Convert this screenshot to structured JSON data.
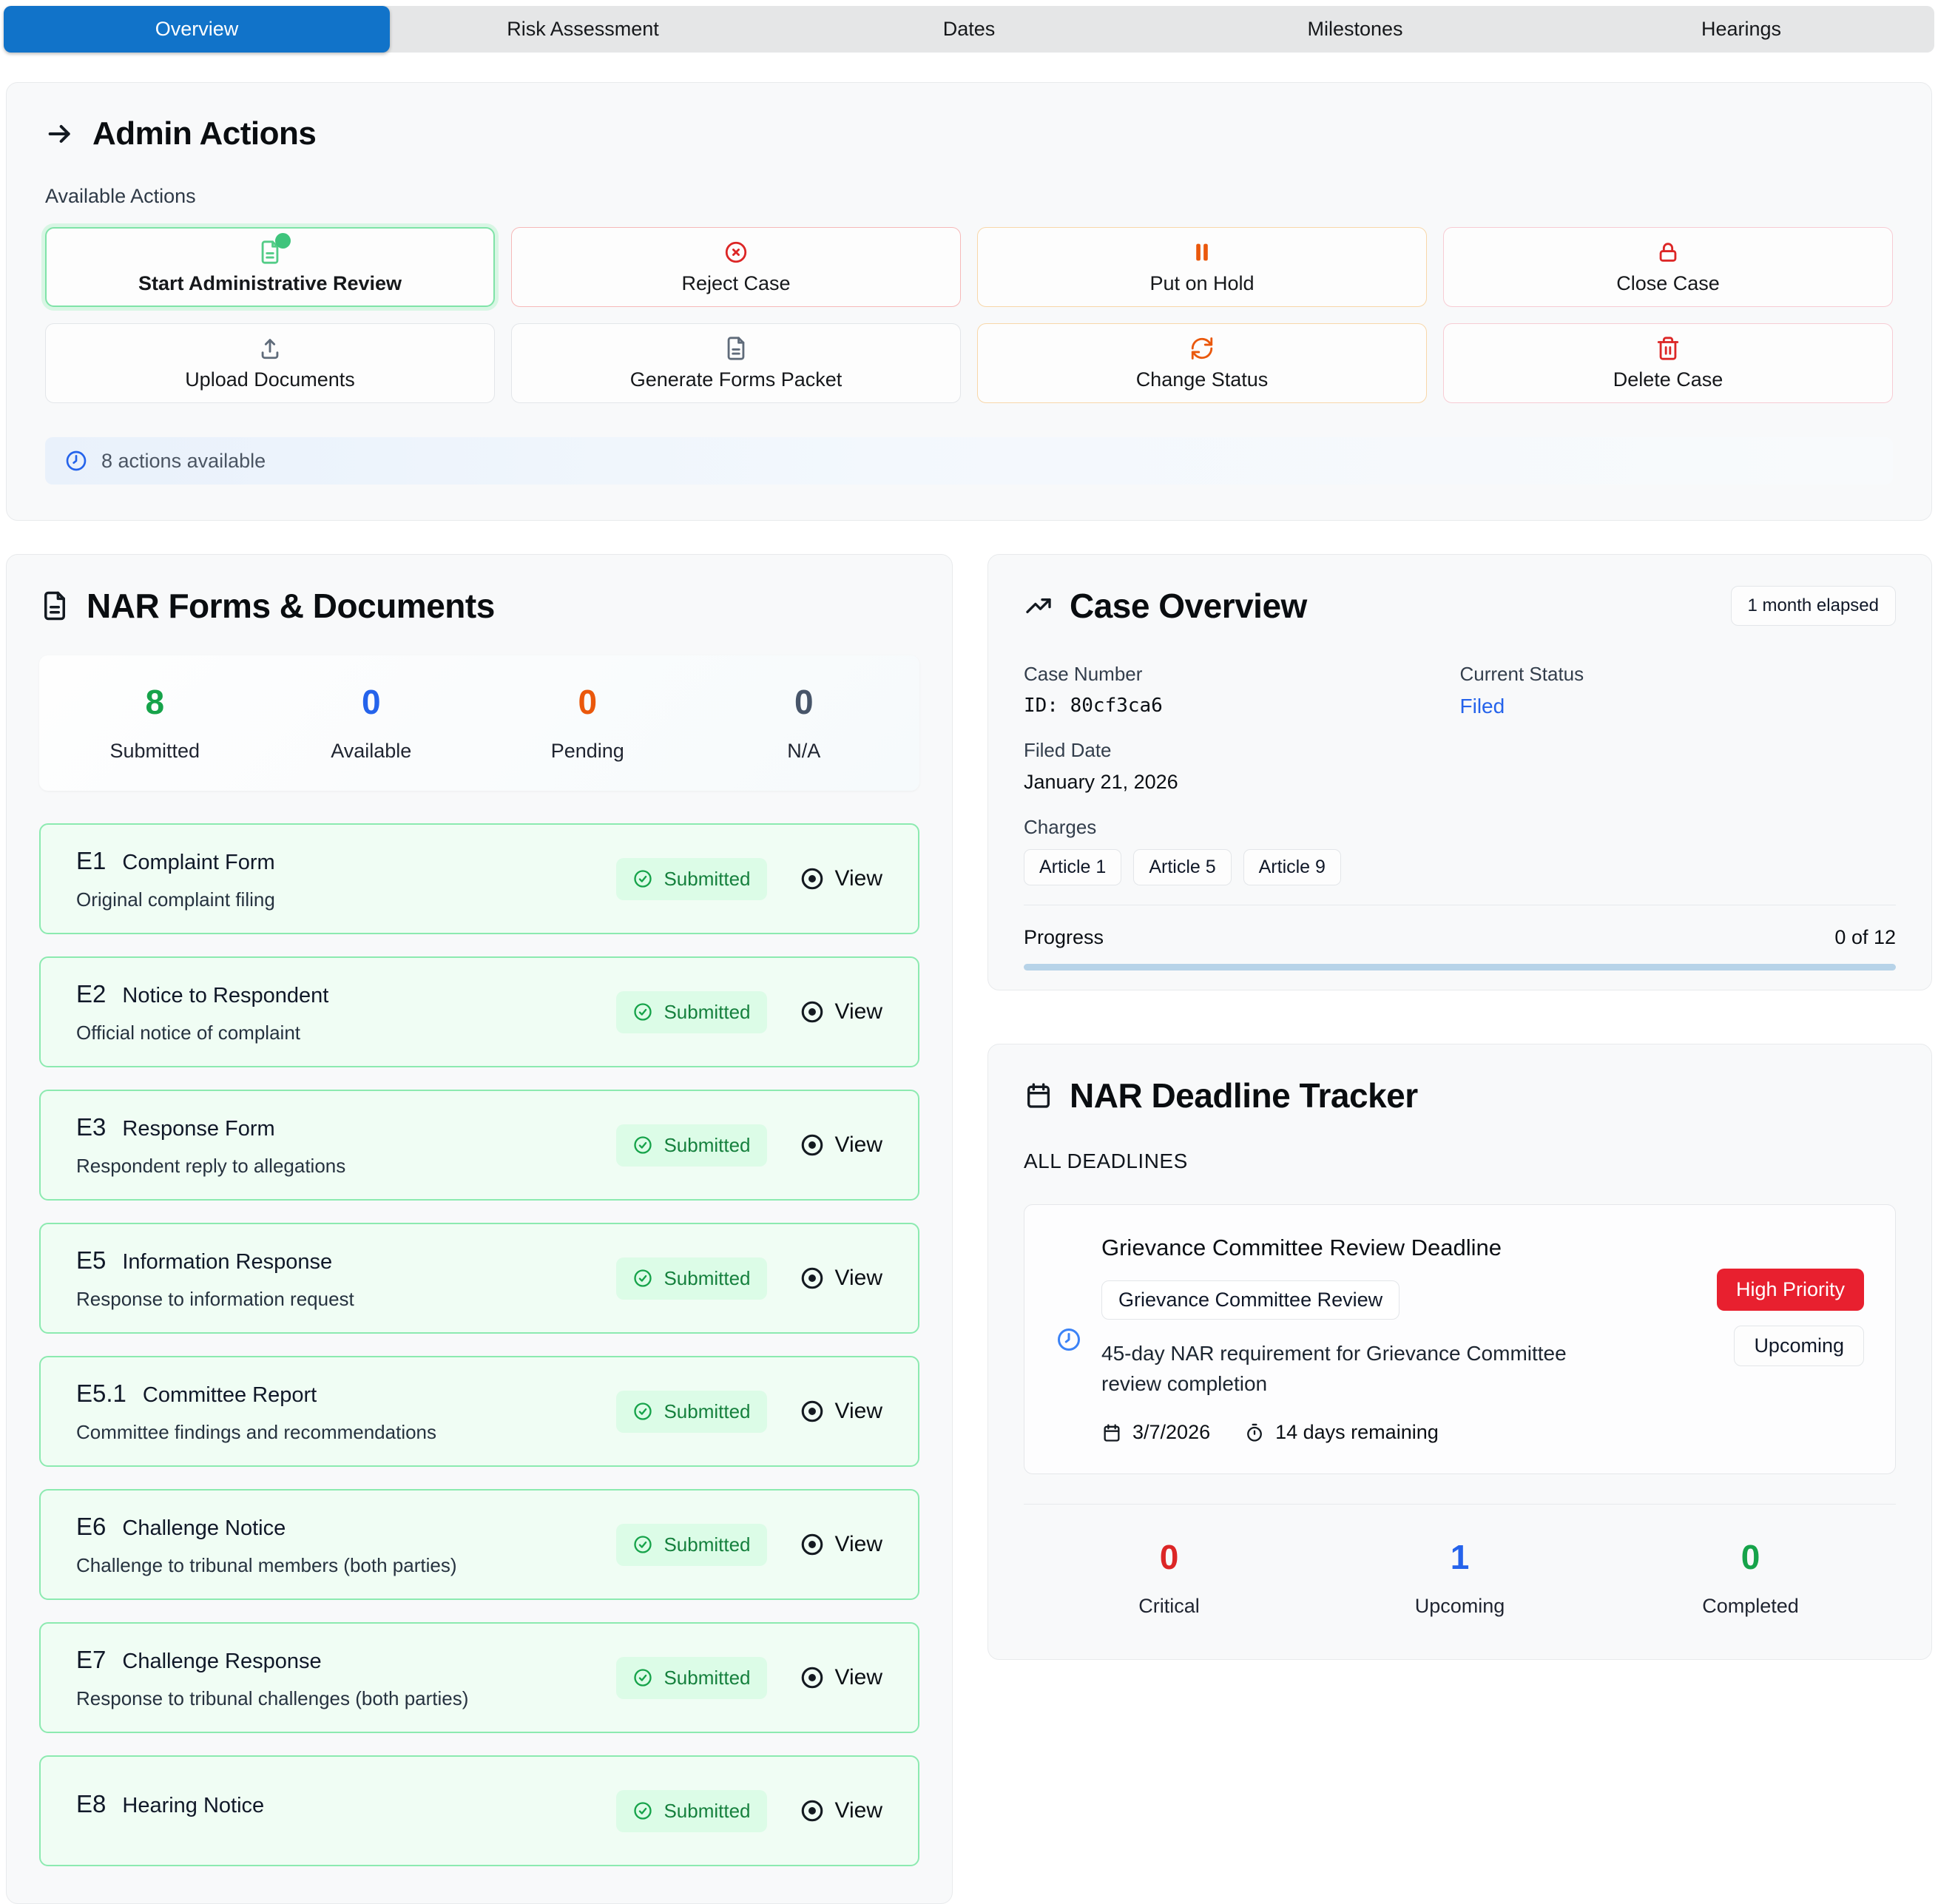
{
  "tabs": {
    "items": [
      {
        "label": "Overview",
        "active": true
      },
      {
        "label": "Risk Assessment",
        "active": false
      },
      {
        "label": "Dates",
        "active": false
      },
      {
        "label": "Milestones",
        "active": false
      },
      {
        "label": "Hearings",
        "active": false
      }
    ]
  },
  "admin_actions": {
    "title": "Admin Actions",
    "subtitle": "Available Actions",
    "buttons": [
      {
        "label": "Start Administrative Review",
        "icon": "file-check-icon",
        "variant": "green"
      },
      {
        "label": "Reject Case",
        "icon": "x-circle-icon",
        "variant": "red"
      },
      {
        "label": "Put on Hold",
        "icon": "pause-icon",
        "variant": "orange"
      },
      {
        "label": "Close Case",
        "icon": "lock-icon",
        "variant": "pink"
      },
      {
        "label": "Upload Documents",
        "icon": "upload-icon",
        "variant": "gray"
      },
      {
        "label": "Generate Forms Packet",
        "icon": "file-text-icon",
        "variant": "gray"
      },
      {
        "label": "Change Status",
        "icon": "refresh-icon",
        "variant": "orange"
      },
      {
        "label": "Delete Case",
        "icon": "trash-icon",
        "variant": "pink"
      }
    ],
    "footer": "8 actions available"
  },
  "forms": {
    "title": "NAR Forms & Documents",
    "stats": [
      {
        "value": "8",
        "label": "Submitted",
        "color": "#16a34a"
      },
      {
        "value": "0",
        "label": "Available",
        "color": "#2563eb"
      },
      {
        "value": "0",
        "label": "Pending",
        "color": "#ea580c"
      },
      {
        "value": "0",
        "label": "N/A",
        "color": "#475569"
      }
    ],
    "view_label": "View",
    "items": [
      {
        "code": "E1",
        "name": "Complaint Form",
        "description": "Original complaint filing",
        "status": "Submitted"
      },
      {
        "code": "E2",
        "name": "Notice to Respondent",
        "description": "Official notice of complaint",
        "status": "Submitted"
      },
      {
        "code": "E3",
        "name": "Response Form",
        "description": "Respondent reply to allegations",
        "status": "Submitted"
      },
      {
        "code": "E5",
        "name": "Information Response",
        "description": "Response to information request",
        "status": "Submitted"
      },
      {
        "code": "E5.1",
        "name": "Committee Report",
        "description": "Committee findings and recommendations",
        "status": "Submitted"
      },
      {
        "code": "E6",
        "name": "Challenge Notice",
        "description": "Challenge to tribunal members (both parties)",
        "status": "Submitted"
      },
      {
        "code": "E7",
        "name": "Challenge Response",
        "description": "Response to tribunal challenges (both parties)",
        "status": "Submitted"
      },
      {
        "code": "E8",
        "name": "Hearing Notice",
        "description": "",
        "status": "Submitted"
      }
    ]
  },
  "case_overview": {
    "title": "Case Overview",
    "elapsed_badge": "1 month elapsed",
    "case_number_label": "Case Number",
    "case_number": "ID: 80cf3ca6",
    "status_label": "Current Status",
    "status": "Filed",
    "filed_date_label": "Filed Date",
    "filed_date": "January 21, 2026",
    "charges_label": "Charges",
    "charges": [
      "Article 1",
      "Article 5",
      "Article 9"
    ],
    "progress_label": "Progress",
    "progress_text": "0 of 12"
  },
  "deadline_tracker": {
    "title": "NAR Deadline Tracker",
    "section_label": "ALL DEADLINES",
    "deadline": {
      "title": "Grievance Committee Review Deadline",
      "category": "Grievance Committee Review",
      "description": "45-day NAR requirement for Grievance Committee review completion",
      "due_date": "3/7/2026",
      "remaining": "14 days remaining",
      "priority": "High Priority",
      "status": "Upcoming"
    },
    "stats": [
      {
        "value": "0",
        "label": "Critical",
        "color": "#dc2626"
      },
      {
        "value": "1",
        "label": "Upcoming",
        "color": "#2563eb"
      },
      {
        "value": "0",
        "label": "Completed",
        "color": "#16a34a"
      }
    ]
  },
  "colors": {
    "accent_blue": "#1173c9",
    "status_blue": "#2563eb",
    "success_green": "#16a34a",
    "danger_red": "#dc2626",
    "warning_orange": "#ea580c",
    "priority_red": "#e8202f"
  }
}
